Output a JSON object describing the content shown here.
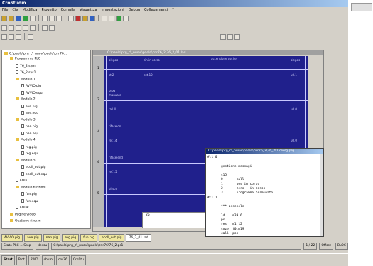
{
  "title": "CroStudio",
  "menu": [
    "File",
    "Cfx",
    "Modifica",
    "Progetto",
    "Compila",
    "Visualizza",
    "Impostazioni",
    "Debug",
    "Collegamenti",
    "?"
  ],
  "tree": {
    "root": "C:\\paolo\\prg_c\\_nuovi\\paolo\\cnr76...",
    "items": [
      {
        "label": "Programma PLC",
        "indent": 1,
        "kind": "folder"
      },
      {
        "label": "76_2.sym",
        "indent": 2,
        "kind": "file"
      },
      {
        "label": "76_2.sys1",
        "indent": 2,
        "kind": "file"
      },
      {
        "label": "Modulo 1",
        "indent": 2,
        "kind": "folder"
      },
      {
        "label": "AVVIO.pig",
        "indent": 3,
        "kind": "file"
      },
      {
        "label": "AVVIO.equ",
        "indent": 3,
        "kind": "file"
      },
      {
        "label": "Modulo 2",
        "indent": 2,
        "kind": "folder"
      },
      {
        "label": "ave.pig",
        "indent": 3,
        "kind": "file"
      },
      {
        "label": "ave.equ",
        "indent": 3,
        "kind": "file"
      },
      {
        "label": "Modulo 3",
        "indent": 2,
        "kind": "folder"
      },
      {
        "label": "nan.pig",
        "indent": 3,
        "kind": "file"
      },
      {
        "label": "nan.equ",
        "indent": 3,
        "kind": "file"
      },
      {
        "label": "Modulo 4",
        "indent": 2,
        "kind": "folder"
      },
      {
        "label": "reg.pig",
        "indent": 3,
        "kind": "file"
      },
      {
        "label": "reg.equ",
        "indent": 3,
        "kind": "file"
      },
      {
        "label": "Modulo 5",
        "indent": 2,
        "kind": "folder"
      },
      {
        "label": "ecoll_out.pig",
        "indent": 3,
        "kind": "file"
      },
      {
        "label": "ecoll_out.equ",
        "indent": 3,
        "kind": "file"
      },
      {
        "label": "END",
        "indent": 2,
        "kind": "file"
      },
      {
        "label": "Modulo funzioni",
        "indent": 2,
        "kind": "folder"
      },
      {
        "label": "fun.pig",
        "indent": 3,
        "kind": "file"
      },
      {
        "label": "fun.equ",
        "indent": 3,
        "kind": "file"
      },
      {
        "label": "ENDP",
        "indent": 2,
        "kind": "file"
      },
      {
        "label": "Pagine video",
        "indent": 1,
        "kind": "folder"
      },
      {
        "label": "Gestione risorse",
        "indent": 1,
        "kind": "folder"
      }
    ]
  },
  "ladder": {
    "title": "C:\\paolo\\prg_c\\_nuovi\\paolo\\cnr76_2\\76_2_01.lad",
    "header": "accensione uscite",
    "labels": [
      {
        "text": "alr.pos"
      },
      {
        "text": "cin in corso"
      },
      {
        "text": "alr.pos"
      },
      {
        "text": "st.2"
      },
      {
        "text": "ext.10"
      },
      {
        "text": "u0.1"
      },
      {
        "text": "prog"
      },
      {
        "text": "manuale"
      },
      {
        "text": "rall.ll"
      },
      {
        "text": "u0.0"
      },
      {
        "text": "rifase.on"
      },
      {
        "text": "ref.14"
      },
      {
        "text": "u0.0"
      },
      {
        "text": "rifase.end"
      },
      {
        "text": "ref.15"
      },
      {
        "text": "ultsce"
      }
    ],
    "rung_numbers": [
      "1",
      "2",
      "3",
      "4",
      "5"
    ]
  },
  "text_editor": {
    "title": "C:\\paolo\\prg_c\\_nuovi\\paolo\\cnr76_2\\76_2\\1.crosg.prg",
    "lines": [
      "#:1 0",
      "",
      "       gestione messagi",
      "",
      "       s15",
      "       0       call",
      "       1       pos in corso",
      "       2       zero   in corso",
      "       3       programma terminato",
      "#:1 1",
      "",
      "       *** assenole",
      "",
      "       ld    m39 6",
      "       ps",
      "       res   m1 12",
      "       soze  f0.m19",
      "       call  pos",
      "       ..."
    ]
  },
  "subwin_value": "25",
  "tabs": [
    {
      "label": "AVVIO.pig",
      "active": false
    },
    {
      "label": "ave.pig",
      "active": false
    },
    {
      "label": "nan.pig",
      "active": false
    },
    {
      "label": "reg.pig",
      "active": false
    },
    {
      "label": "fun.pig",
      "active": false
    },
    {
      "label": "ecoll_out.pig",
      "active": false
    },
    {
      "label": "76_2_01.lad",
      "active": true
    }
  ],
  "status": {
    "state": "Stato PLC = Stop",
    "mode": "Nessu",
    "path": "C:\\paolo\\prg_c\\_nuovi\\paolo\\cnr76\\76_2.pr1",
    "pos": "1 / 22",
    "extra1": "Offset",
    "extra2": "BLOC"
  },
  "taskbar": [
    "Start",
    "Prot",
    "RWD",
    "chkm",
    "cnr76",
    "CroStu"
  ],
  "colors": {
    "ladder_bg": "#20208c",
    "title_gradient": "#0a246a"
  }
}
